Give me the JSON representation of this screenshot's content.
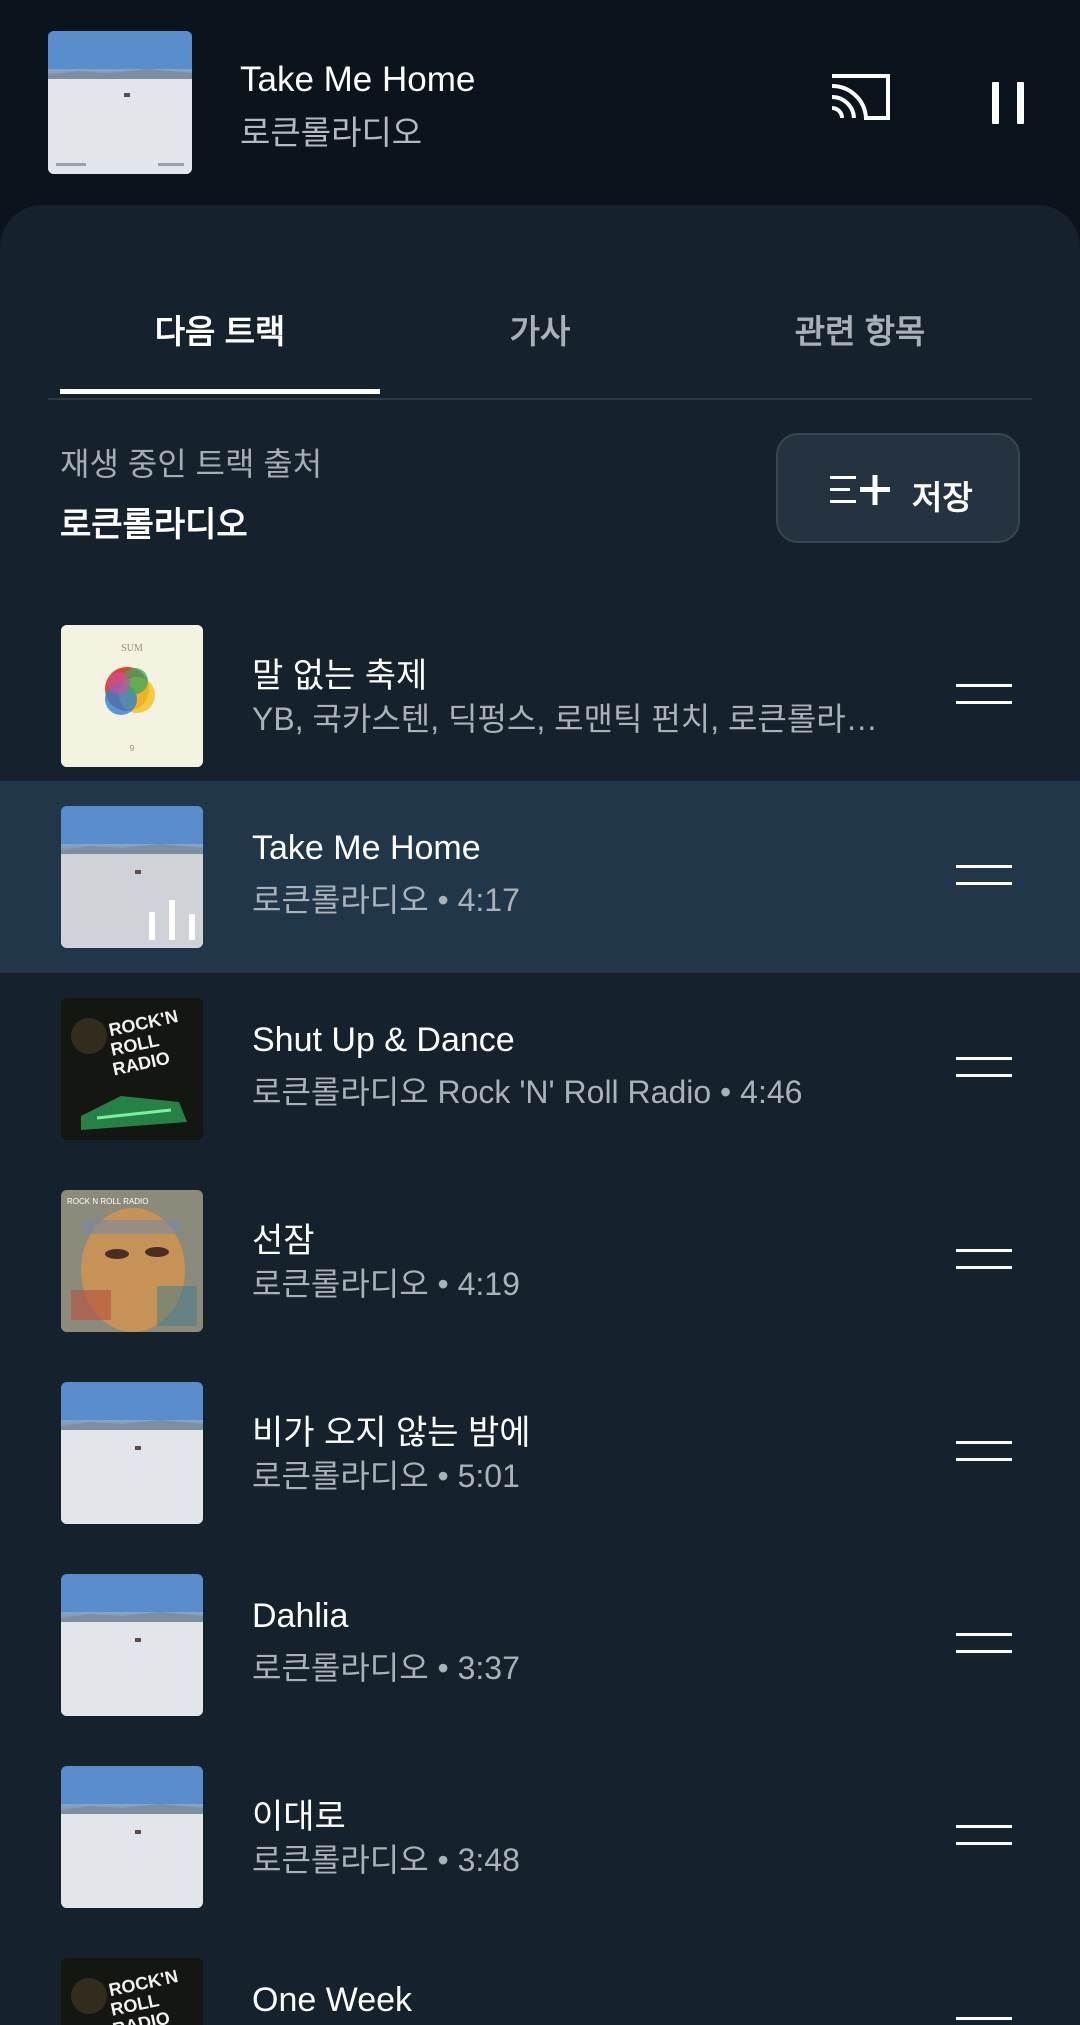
{
  "now_playing": {
    "title": "Take Me Home",
    "artist": "로큰롤라디오",
    "cast_icon": "cast-icon",
    "pause_icon": "pause-icon"
  },
  "tabs": [
    {
      "label": "다음 트랙",
      "active": true
    },
    {
      "label": "가사",
      "active": false
    },
    {
      "label": "관련 항목",
      "active": false
    }
  ],
  "queue_source": {
    "label": "재생 중인 트랙 출처",
    "name": "로큰롤라디오",
    "save_label": "저장",
    "save_icon": "playlist-add-icon"
  },
  "tracks": [
    {
      "title": "말 없는 축제",
      "subtitle": "YB, 국카스텐, 딕펑스, 로맨틱 펀치, 로큰롤라디오, 게이트플라워즈",
      "art": "sum-album",
      "playing": false
    },
    {
      "title": "Take Me Home",
      "subtitle": "로큰롤라디오 • 4:17",
      "art": "salt-flat-album",
      "playing": true
    },
    {
      "title": "Shut Up & Dance",
      "subtitle": "로큰롤라디오 Rock 'N' Roll Radio • 4:46",
      "art": "rock-n-roll-radio-album",
      "playing": false
    },
    {
      "title": "선잠",
      "subtitle": "로큰롤라디오 • 4:19",
      "art": "face-mosaic-album",
      "playing": false
    },
    {
      "title": "비가 오지 않는 밤에",
      "subtitle": "로큰롤라디오 • 5:01",
      "art": "salt-flat-album",
      "playing": false
    },
    {
      "title": "Dahlia",
      "subtitle": "로큰롤라디오 • 3:37",
      "art": "salt-flat-album",
      "playing": false
    },
    {
      "title": "이대로",
      "subtitle": "로큰롤라디오 • 3:48",
      "art": "salt-flat-album",
      "playing": false
    },
    {
      "title": "One Week",
      "subtitle": "",
      "art": "rock-n-roll-radio-album",
      "playing": false
    }
  ]
}
